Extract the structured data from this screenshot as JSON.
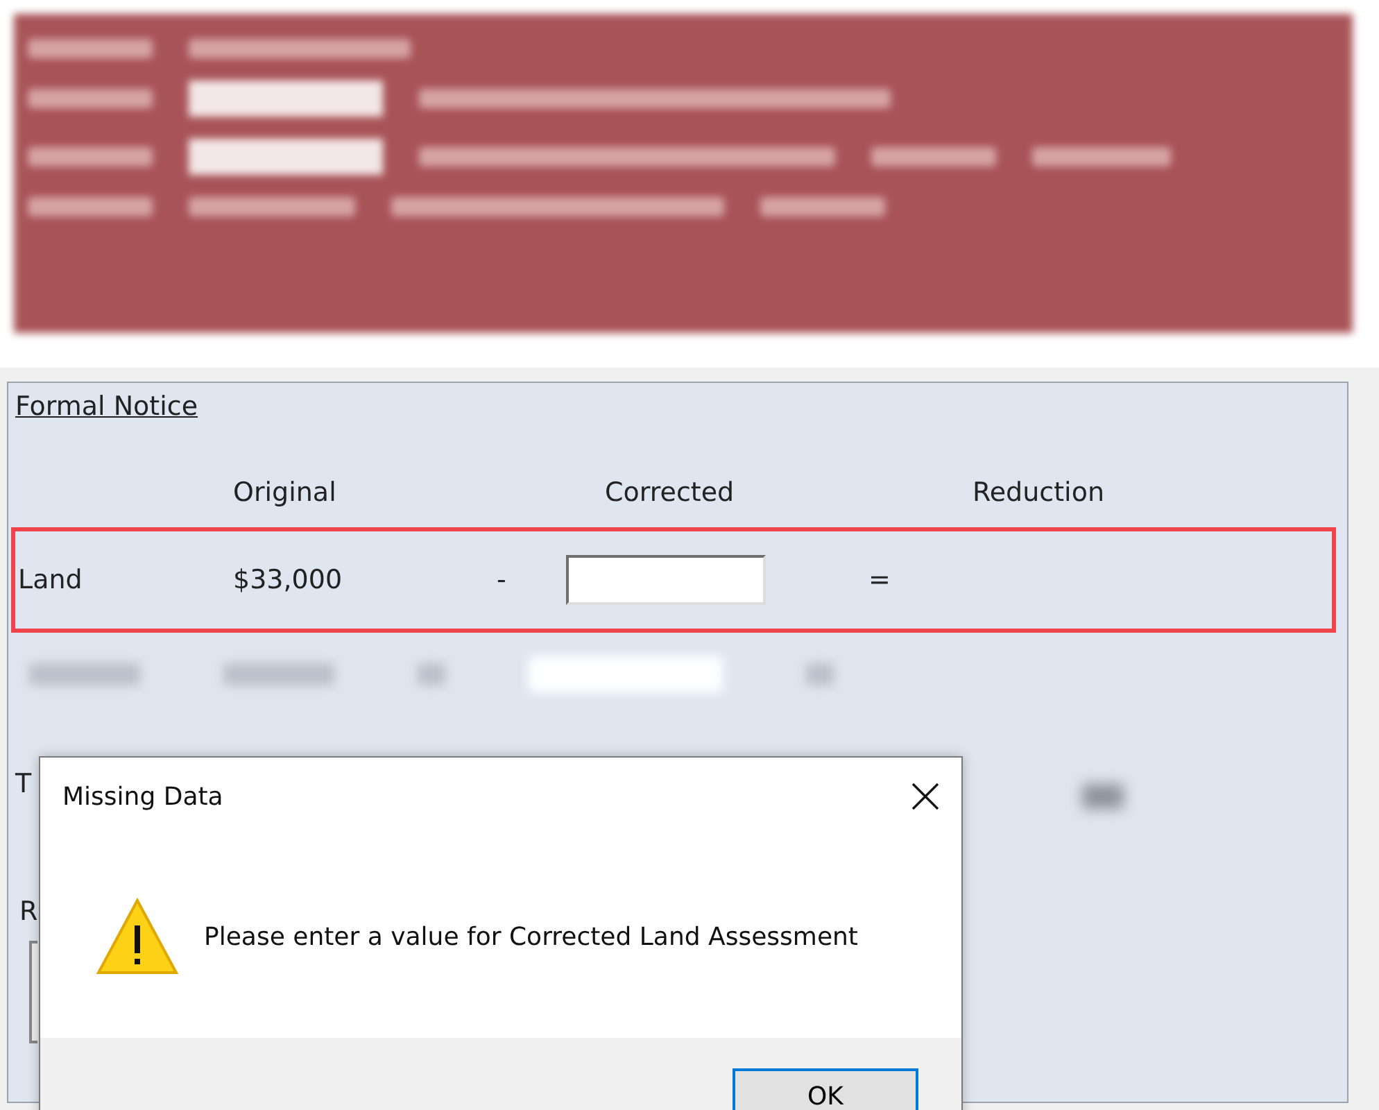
{
  "panel": {
    "title": "Formal Notice",
    "columns": [
      "Original",
      "Corrected",
      "Reduction"
    ],
    "row": {
      "label": "Land",
      "original": "$33,000",
      "operator": "-",
      "equals": "=",
      "highlighted": true
    },
    "partial_labels": [
      "T",
      "R"
    ]
  },
  "dialog": {
    "title": "Missing Data",
    "message": "Please enter a value for Corrected Land Assessment",
    "buttons": [
      {
        "label": "OK",
        "default": true
      }
    ]
  }
}
